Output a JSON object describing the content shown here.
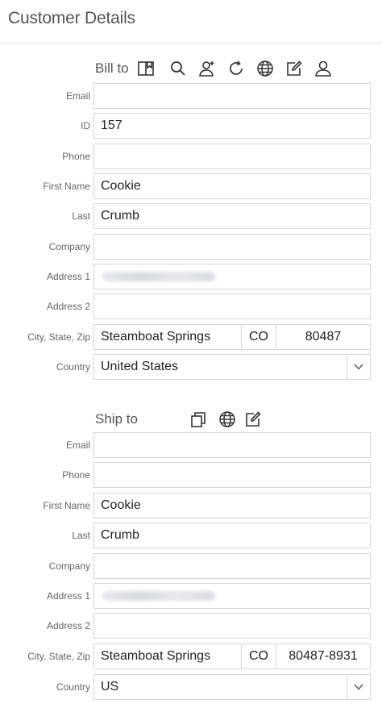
{
  "page": {
    "title": "Customer Details"
  },
  "bill_to": {
    "section_label": "Bill to",
    "toolbar_icons": [
      "book-icon",
      "search-icon",
      "add-user-icon",
      "refresh-icon",
      "globe-icon",
      "edit-icon",
      "user-icon"
    ],
    "fields": {
      "email": {
        "label": "Email",
        "value": ""
      },
      "id": {
        "label": "ID",
        "value": "157"
      },
      "phone": {
        "label": "Phone",
        "value": ""
      },
      "first_name": {
        "label": "First Name",
        "value": "Cookie"
      },
      "last": {
        "label": "Last",
        "value": "Crumb"
      },
      "company": {
        "label": "Company",
        "value": ""
      },
      "address1": {
        "label": "Address 1",
        "value": ""
      },
      "address2": {
        "label": "Address 2",
        "value": ""
      },
      "city_state_zip": {
        "label": "City, State, Zip",
        "city": "Steamboat Springs",
        "state": "CO",
        "zip": "80487"
      },
      "country": {
        "label": "Country",
        "value": "United States"
      }
    }
  },
  "ship_to": {
    "section_label": "Ship to",
    "toolbar_icons": [
      "copy-icon",
      "globe-icon",
      "edit-icon"
    ],
    "fields": {
      "email": {
        "label": "Email",
        "value": ""
      },
      "phone": {
        "label": "Phone",
        "value": ""
      },
      "first_name": {
        "label": "First Name",
        "value": "Cookie"
      },
      "last": {
        "label": "Last",
        "value": "Crumb"
      },
      "company": {
        "label": "Company",
        "value": ""
      },
      "address1": {
        "label": "Address 1",
        "value": ""
      },
      "address2": {
        "label": "Address 2",
        "value": ""
      },
      "city_state_zip": {
        "label": "City, State, Zip",
        "city": "Steamboat Springs",
        "state": "CO",
        "zip": "80487-8931"
      },
      "country": {
        "label": "Country",
        "value": "US"
      }
    }
  }
}
